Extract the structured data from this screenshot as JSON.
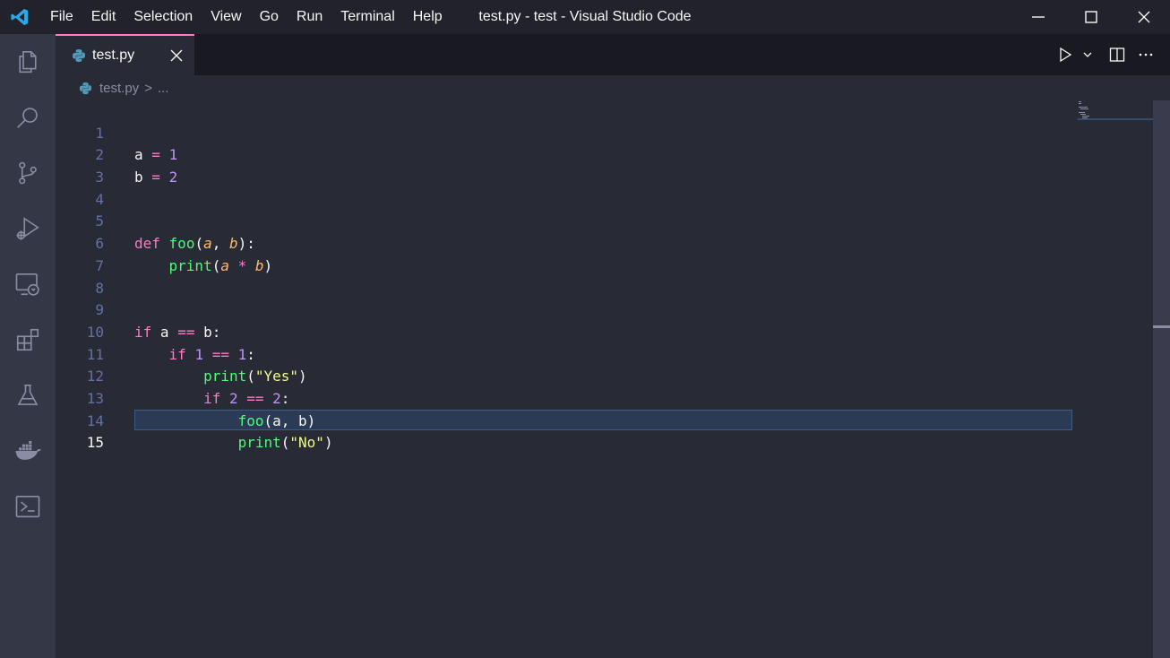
{
  "window": {
    "title": "test.py - test - Visual Studio Code"
  },
  "menu": {
    "items": [
      "File",
      "Edit",
      "Selection",
      "View",
      "Go",
      "Run",
      "Terminal",
      "Help"
    ]
  },
  "activity_bar": {
    "icons": [
      "explorer-icon",
      "search-icon",
      "source-control-icon",
      "run-debug-icon",
      "remote-explorer-icon",
      "extensions-icon",
      "testing-icon",
      "docker-icon",
      "powershell-icon"
    ]
  },
  "tabs": [
    {
      "label": "test.py",
      "active": true,
      "icon": "python-file-icon"
    }
  ],
  "breadcrumb": {
    "file": "test.py",
    "separator": ">",
    "more": "..."
  },
  "editor": {
    "active_line": 15,
    "lines": [
      {
        "n": "1"
      },
      {
        "n": "2"
      },
      {
        "n": "3"
      },
      {
        "n": "4"
      },
      {
        "n": "5"
      },
      {
        "n": "6"
      },
      {
        "n": "7"
      },
      {
        "n": "8"
      },
      {
        "n": "9"
      },
      {
        "n": "10"
      },
      {
        "n": "11"
      },
      {
        "n": "12"
      },
      {
        "n": "13"
      },
      {
        "n": "14"
      },
      {
        "n": "15"
      }
    ],
    "tokens": {
      "l1": [
        "a",
        "=",
        "1"
      ],
      "l2": [
        "b",
        "=",
        "2"
      ],
      "l5": [
        "def",
        "foo",
        "(",
        "a",
        ", ",
        "b",
        "):"
      ],
      "l6": [
        "print",
        "(",
        "a",
        "*",
        "b",
        ")"
      ],
      "l9": [
        "if",
        "a",
        "==",
        "b:"
      ],
      "l10": [
        "if",
        "1",
        "==",
        "1",
        ":"
      ],
      "l11": [
        "print",
        "(",
        "\"Yes\"",
        ")"
      ],
      "l12": [
        "if",
        "2",
        "==",
        "2",
        ":"
      ],
      "l13": [
        "foo",
        "(a, b)"
      ],
      "l14": [
        "print",
        "(",
        "\"No\"",
        ")"
      ]
    }
  },
  "colors": {
    "keyword": "#ff79c6",
    "number": "#bd93f9",
    "function": "#50fa7b",
    "parameter": "#ffb86c",
    "string": "#f1fa8c",
    "tab_accent": "#ff79c6"
  }
}
